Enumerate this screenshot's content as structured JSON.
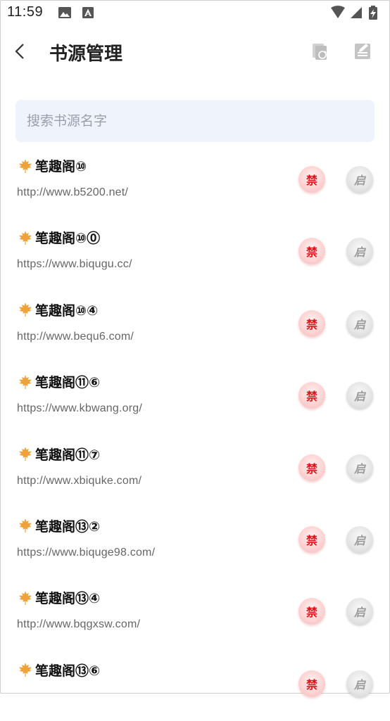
{
  "status_bar": {
    "time": "11:59"
  },
  "header": {
    "title": "书源管理",
    "back_icon": "back-chevron-icon",
    "copy_icon": "copy-refresh-icon",
    "edit_icon": "edit-note-icon"
  },
  "search": {
    "placeholder": "搜索书源名字",
    "value": ""
  },
  "sources": [
    {
      "name": "笔趣阁⑩",
      "url": "http://www.b5200.net/",
      "ban_label": "禁",
      "enable_label": "启"
    },
    {
      "name": "笔趣阁⑩⓪",
      "url": "https://www.biqugu.cc/",
      "ban_label": "禁",
      "enable_label": "启"
    },
    {
      "name": "笔趣阁⑩④",
      "url": "http://www.bequ6.com/",
      "ban_label": "禁",
      "enable_label": "启"
    },
    {
      "name": "笔趣阁⑪⑥",
      "url": "https://www.kbwang.org/",
      "ban_label": "禁",
      "enable_label": "启"
    },
    {
      "name": "笔趣阁⑪⑦",
      "url": "http://www.xbiquke.com/",
      "ban_label": "禁",
      "enable_label": "启"
    },
    {
      "name": "笔趣阁⑬②",
      "url": "https://www.biquge98.com/",
      "ban_label": "禁",
      "enable_label": "启"
    },
    {
      "name": "笔趣阁⑬④",
      "url": "http://www.bqgxsw.com/",
      "ban_label": "禁",
      "enable_label": "启"
    },
    {
      "name": "笔趣阁⑬⑥",
      "url": "",
      "ban_label": "禁",
      "enable_label": "启"
    }
  ],
  "colors": {
    "ban_text": "#e2141b",
    "search_bg": "#eff3fb",
    "leaf": "#f0a23a"
  }
}
